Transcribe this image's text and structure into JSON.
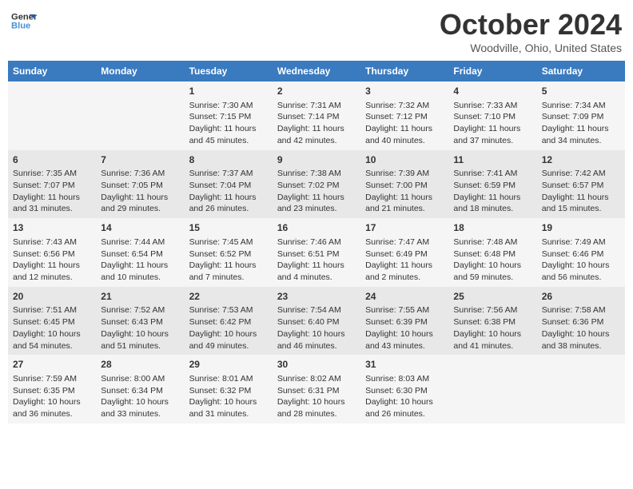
{
  "header": {
    "logo_line1": "General",
    "logo_line2": "Blue",
    "month": "October 2024",
    "location": "Woodville, Ohio, United States"
  },
  "days_of_week": [
    "Sunday",
    "Monday",
    "Tuesday",
    "Wednesday",
    "Thursday",
    "Friday",
    "Saturday"
  ],
  "weeks": [
    [
      {
        "day": "",
        "info": ""
      },
      {
        "day": "",
        "info": ""
      },
      {
        "day": "1",
        "info": "Sunrise: 7:30 AM\nSunset: 7:15 PM\nDaylight: 11 hours and 45 minutes."
      },
      {
        "day": "2",
        "info": "Sunrise: 7:31 AM\nSunset: 7:14 PM\nDaylight: 11 hours and 42 minutes."
      },
      {
        "day": "3",
        "info": "Sunrise: 7:32 AM\nSunset: 7:12 PM\nDaylight: 11 hours and 40 minutes."
      },
      {
        "day": "4",
        "info": "Sunrise: 7:33 AM\nSunset: 7:10 PM\nDaylight: 11 hours and 37 minutes."
      },
      {
        "day": "5",
        "info": "Sunrise: 7:34 AM\nSunset: 7:09 PM\nDaylight: 11 hours and 34 minutes."
      }
    ],
    [
      {
        "day": "6",
        "info": "Sunrise: 7:35 AM\nSunset: 7:07 PM\nDaylight: 11 hours and 31 minutes."
      },
      {
        "day": "7",
        "info": "Sunrise: 7:36 AM\nSunset: 7:05 PM\nDaylight: 11 hours and 29 minutes."
      },
      {
        "day": "8",
        "info": "Sunrise: 7:37 AM\nSunset: 7:04 PM\nDaylight: 11 hours and 26 minutes."
      },
      {
        "day": "9",
        "info": "Sunrise: 7:38 AM\nSunset: 7:02 PM\nDaylight: 11 hours and 23 minutes."
      },
      {
        "day": "10",
        "info": "Sunrise: 7:39 AM\nSunset: 7:00 PM\nDaylight: 11 hours and 21 minutes."
      },
      {
        "day": "11",
        "info": "Sunrise: 7:41 AM\nSunset: 6:59 PM\nDaylight: 11 hours and 18 minutes."
      },
      {
        "day": "12",
        "info": "Sunrise: 7:42 AM\nSunset: 6:57 PM\nDaylight: 11 hours and 15 minutes."
      }
    ],
    [
      {
        "day": "13",
        "info": "Sunrise: 7:43 AM\nSunset: 6:56 PM\nDaylight: 11 hours and 12 minutes."
      },
      {
        "day": "14",
        "info": "Sunrise: 7:44 AM\nSunset: 6:54 PM\nDaylight: 11 hours and 10 minutes."
      },
      {
        "day": "15",
        "info": "Sunrise: 7:45 AM\nSunset: 6:52 PM\nDaylight: 11 hours and 7 minutes."
      },
      {
        "day": "16",
        "info": "Sunrise: 7:46 AM\nSunset: 6:51 PM\nDaylight: 11 hours and 4 minutes."
      },
      {
        "day": "17",
        "info": "Sunrise: 7:47 AM\nSunset: 6:49 PM\nDaylight: 11 hours and 2 minutes."
      },
      {
        "day": "18",
        "info": "Sunrise: 7:48 AM\nSunset: 6:48 PM\nDaylight: 10 hours and 59 minutes."
      },
      {
        "day": "19",
        "info": "Sunrise: 7:49 AM\nSunset: 6:46 PM\nDaylight: 10 hours and 56 minutes."
      }
    ],
    [
      {
        "day": "20",
        "info": "Sunrise: 7:51 AM\nSunset: 6:45 PM\nDaylight: 10 hours and 54 minutes."
      },
      {
        "day": "21",
        "info": "Sunrise: 7:52 AM\nSunset: 6:43 PM\nDaylight: 10 hours and 51 minutes."
      },
      {
        "day": "22",
        "info": "Sunrise: 7:53 AM\nSunset: 6:42 PM\nDaylight: 10 hours and 49 minutes."
      },
      {
        "day": "23",
        "info": "Sunrise: 7:54 AM\nSunset: 6:40 PM\nDaylight: 10 hours and 46 minutes."
      },
      {
        "day": "24",
        "info": "Sunrise: 7:55 AM\nSunset: 6:39 PM\nDaylight: 10 hours and 43 minutes."
      },
      {
        "day": "25",
        "info": "Sunrise: 7:56 AM\nSunset: 6:38 PM\nDaylight: 10 hours and 41 minutes."
      },
      {
        "day": "26",
        "info": "Sunrise: 7:58 AM\nSunset: 6:36 PM\nDaylight: 10 hours and 38 minutes."
      }
    ],
    [
      {
        "day": "27",
        "info": "Sunrise: 7:59 AM\nSunset: 6:35 PM\nDaylight: 10 hours and 36 minutes."
      },
      {
        "day": "28",
        "info": "Sunrise: 8:00 AM\nSunset: 6:34 PM\nDaylight: 10 hours and 33 minutes."
      },
      {
        "day": "29",
        "info": "Sunrise: 8:01 AM\nSunset: 6:32 PM\nDaylight: 10 hours and 31 minutes."
      },
      {
        "day": "30",
        "info": "Sunrise: 8:02 AM\nSunset: 6:31 PM\nDaylight: 10 hours and 28 minutes."
      },
      {
        "day": "31",
        "info": "Sunrise: 8:03 AM\nSunset: 6:30 PM\nDaylight: 10 hours and 26 minutes."
      },
      {
        "day": "",
        "info": ""
      },
      {
        "day": "",
        "info": ""
      }
    ]
  ]
}
